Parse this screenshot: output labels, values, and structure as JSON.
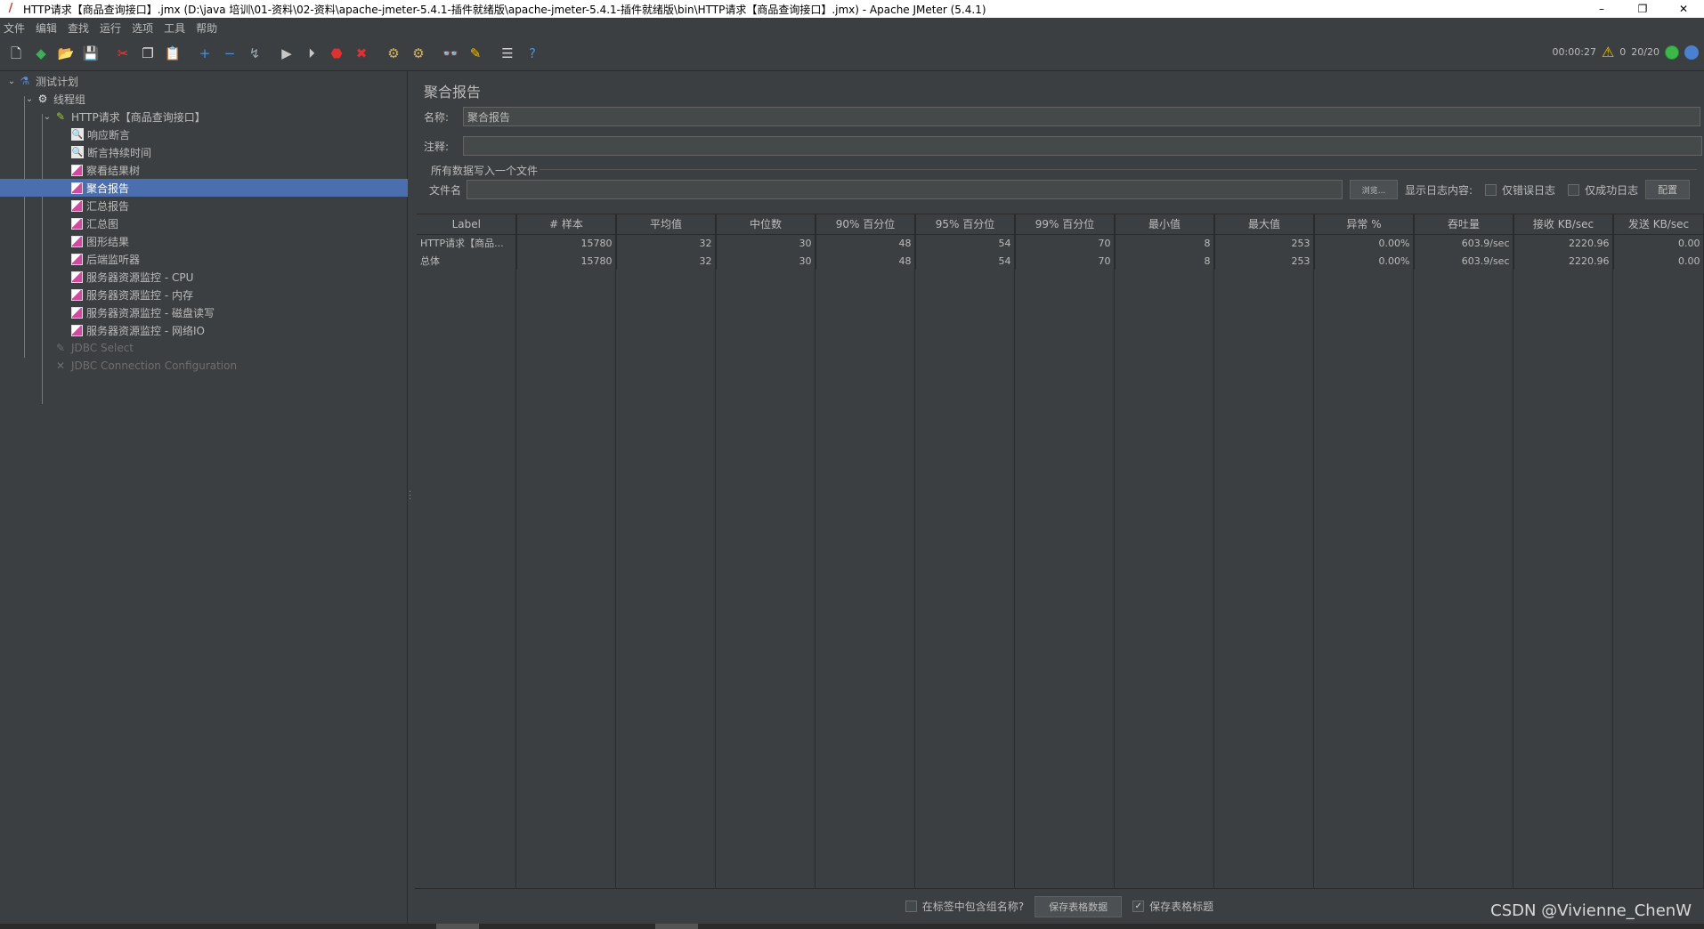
{
  "window": {
    "title": "HTTP请求【商品查询接口】.jmx (D:\\java 培训\\01-资料\\02-资料\\apache-jmeter-5.4.1-插件就绪版\\apache-jmeter-5.4.1-插件就绪版\\bin\\HTTP请求【商品查询接口】.jmx) - Apache JMeter (5.4.1)",
    "minimize": "–",
    "restore": "❐",
    "close": "✕"
  },
  "menu": [
    "文件",
    "编辑",
    "查找",
    "运行",
    "选项",
    "工具",
    "帮助"
  ],
  "toolbar": {
    "buttons": [
      {
        "name": "new-icon",
        "glyph": "🗋",
        "color": "#e8e8e8"
      },
      {
        "name": "templates-icon",
        "glyph": "◆",
        "color": "#3fae5a"
      },
      {
        "name": "open-icon",
        "glyph": "📂",
        "color": "#d9a441"
      },
      {
        "name": "save-icon",
        "glyph": "💾",
        "color": "#d0d0d0"
      },
      {
        "name": "sep"
      },
      {
        "name": "cut-icon",
        "glyph": "✂",
        "color": "#e04040"
      },
      {
        "name": "copy-icon",
        "glyph": "❐",
        "color": "#e0e0e0"
      },
      {
        "name": "paste-icon",
        "glyph": "📋",
        "color": "#d9b060"
      },
      {
        "name": "sep"
      },
      {
        "name": "expand-icon",
        "glyph": "+",
        "color": "#4a90e0"
      },
      {
        "name": "collapse-icon",
        "glyph": "−",
        "color": "#4a90e0"
      },
      {
        "name": "toggle-icon",
        "glyph": "↯",
        "color": "#9aa8b8"
      },
      {
        "name": "sep"
      },
      {
        "name": "start-icon",
        "glyph": "▶",
        "color": "#c8c8c8"
      },
      {
        "name": "start-no-pause-icon",
        "glyph": "⏵",
        "color": "#c8c8c8"
      },
      {
        "name": "stop-icon",
        "glyph": "⬣",
        "color": "#e03030"
      },
      {
        "name": "shutdown-icon",
        "glyph": "✖",
        "color": "#e03030"
      },
      {
        "name": "sep"
      },
      {
        "name": "clear-icon",
        "glyph": "⚙",
        "color": "#d9b060"
      },
      {
        "name": "clear-all-icon",
        "glyph": "⚙",
        "color": "#d9b060"
      },
      {
        "name": "sep"
      },
      {
        "name": "search-icon",
        "glyph": "👓",
        "color": "#c8c8c8"
      },
      {
        "name": "reset-search-icon",
        "glyph": "✎",
        "color": "#f0c000"
      },
      {
        "name": "sep"
      },
      {
        "name": "function-helper-icon",
        "glyph": "☰",
        "color": "#d0d0d0"
      },
      {
        "name": "help-icon",
        "glyph": "?",
        "color": "#4a90e0"
      }
    ],
    "elapsed": "00:00:27",
    "warnings": "0",
    "threads": "20/20"
  },
  "tree": [
    {
      "label": "测试计划",
      "depth": 0,
      "toggle": "⌄",
      "icon": "flask",
      "state": "normal"
    },
    {
      "label": "线程组",
      "depth": 1,
      "toggle": "⌄",
      "icon": "gear",
      "state": "normal"
    },
    {
      "label": "HTTP请求【商品查询接口】",
      "depth": 2,
      "toggle": "⌄",
      "icon": "pen",
      "state": "normal"
    },
    {
      "label": "响应断言",
      "depth": 3,
      "toggle": "",
      "icon": "assert",
      "state": "normal"
    },
    {
      "label": "断言持续时间",
      "depth": 3,
      "toggle": "",
      "icon": "assert",
      "state": "normal"
    },
    {
      "label": "察看结果树",
      "depth": 3,
      "toggle": "",
      "icon": "chart",
      "state": "normal"
    },
    {
      "label": "聚合报告",
      "depth": 3,
      "toggle": "",
      "icon": "chart",
      "state": "selected"
    },
    {
      "label": "汇总报告",
      "depth": 3,
      "toggle": "",
      "icon": "chart",
      "state": "normal"
    },
    {
      "label": "汇总图",
      "depth": 3,
      "toggle": "",
      "icon": "chart",
      "state": "normal"
    },
    {
      "label": "图形结果",
      "depth": 3,
      "toggle": "",
      "icon": "chart",
      "state": "normal"
    },
    {
      "label": "后端监听器",
      "depth": 3,
      "toggle": "",
      "icon": "chart",
      "state": "normal"
    },
    {
      "label": "服务器资源监控 - CPU",
      "depth": 3,
      "toggle": "",
      "icon": "chart",
      "state": "normal"
    },
    {
      "label": "服务器资源监控 - 内存",
      "depth": 3,
      "toggle": "",
      "icon": "chart",
      "state": "normal"
    },
    {
      "label": "服务器资源监控 - 磁盘读写",
      "depth": 3,
      "toggle": "",
      "icon": "chart",
      "state": "normal"
    },
    {
      "label": "服务器资源监控 - 网络IO",
      "depth": 3,
      "toggle": "",
      "icon": "chart",
      "state": "normal"
    },
    {
      "label": "JDBC Select",
      "depth": 2,
      "toggle": "",
      "icon": "pen",
      "state": "disabled"
    },
    {
      "label": "JDBC Connection Configuration",
      "depth": 2,
      "toggle": "",
      "icon": "tools",
      "state": "disabled"
    }
  ],
  "panel": {
    "title": "聚合报告",
    "name_label": "名称:",
    "name_value": "聚合报告",
    "comment_label": "注释:",
    "comment_value": "",
    "file_legend": "所有数据写入一个文件",
    "filename_label": "文件名",
    "filename_value": "",
    "browse_button": "浏览...",
    "log_content_label": "显示日志内容:",
    "errors_only_label": "仅错误日志",
    "success_only_label": "仅成功日志",
    "configure_button": "配置"
  },
  "table": {
    "headers": [
      "Label",
      "# 样本",
      "平均值",
      "中位数",
      "90% 百分位",
      "95% 百分位",
      "99% 百分位",
      "最小值",
      "最大值",
      "异常 %",
      "吞吐量",
      "接收 KB/sec",
      "发送 KB/sec"
    ],
    "rows": [
      [
        "HTTP请求【商品...",
        "15780",
        "32",
        "30",
        "48",
        "54",
        "70",
        "8",
        "253",
        "0.00%",
        "603.9/sec",
        "2220.96",
        "0.00"
      ],
      [
        "总体",
        "15780",
        "32",
        "30",
        "48",
        "54",
        "70",
        "8",
        "253",
        "0.00%",
        "603.9/sec",
        "2220.96",
        "0.00"
      ]
    ]
  },
  "bottom": {
    "include_group_label": "在标签中包含组名称?",
    "save_table_button": "保存表格数据",
    "save_header_label": "保存表格标题"
  },
  "watermark": "CSDN @Vivienne_ChenW"
}
